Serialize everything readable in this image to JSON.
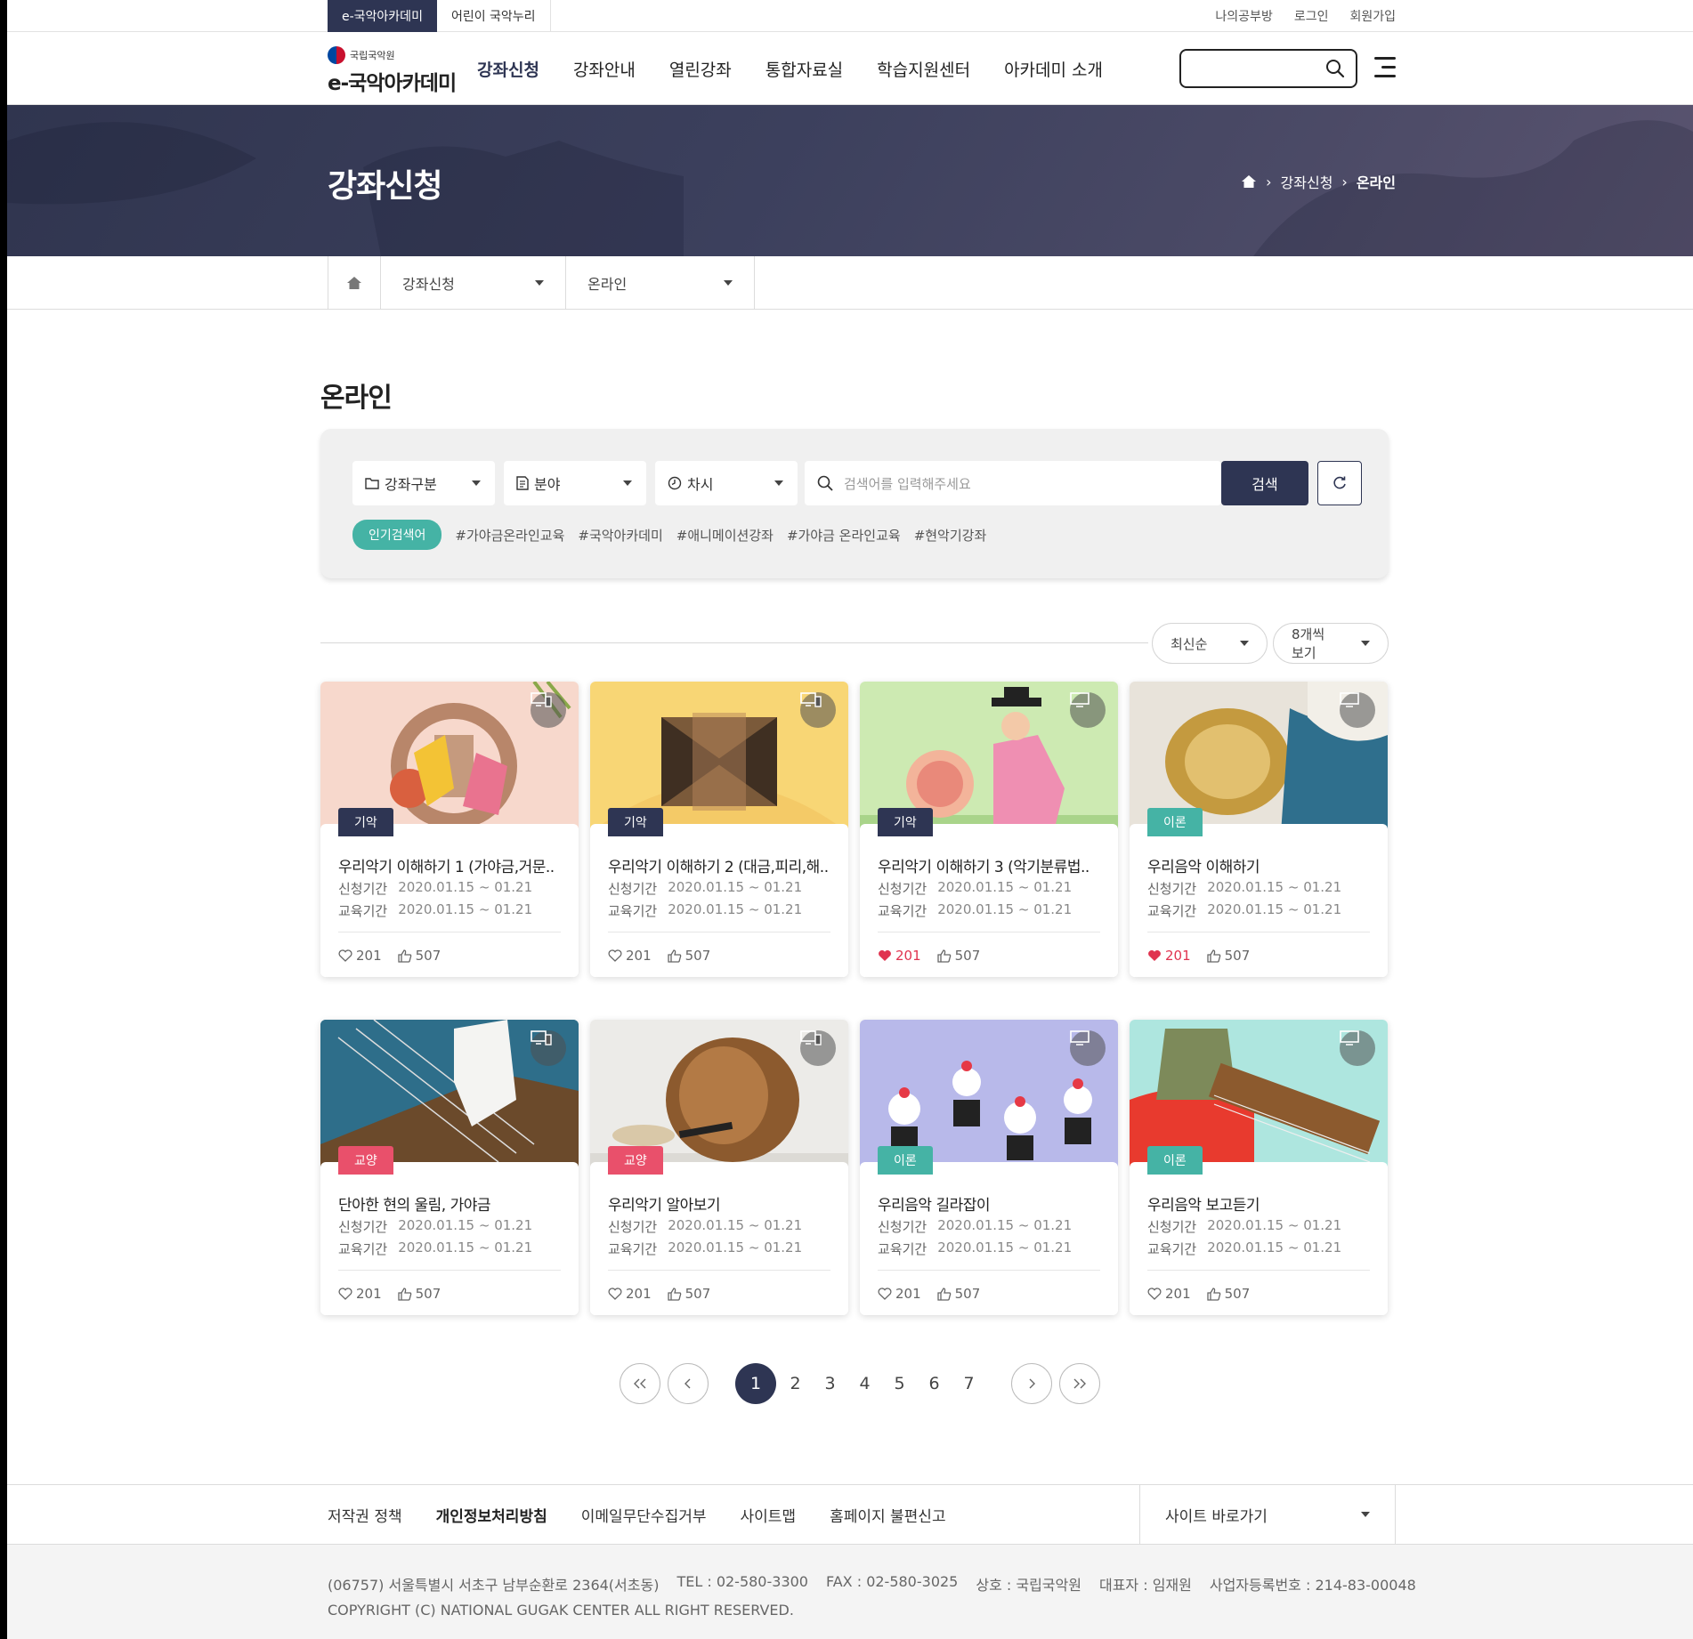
{
  "top": {
    "site_tabs": [
      "e-국악아카데미",
      "어린이 국악누리"
    ],
    "util_links": [
      "나의공부방",
      "로그인",
      "회원가입"
    ]
  },
  "header": {
    "logo_sub": "국립국악원",
    "logo_main": "e-국악아카데미",
    "nav": [
      "강좌신청",
      "강좌안내",
      "열린강좌",
      "통합자료실",
      "학습지원센터",
      "아카데미 소개"
    ],
    "active_nav_index": 0
  },
  "hero": {
    "title": "강좌신청",
    "breadcrumb": [
      "강좌신청",
      "온라인"
    ]
  },
  "subnav": {
    "select1": "강좌신청",
    "select2": "온라인"
  },
  "section": {
    "title": "온라인"
  },
  "filter": {
    "selects": [
      {
        "label": "강좌구분",
        "icon": "folder-icon"
      },
      {
        "label": "분야",
        "icon": "document-icon"
      },
      {
        "label": "차시",
        "icon": "clock-icon"
      }
    ],
    "search_placeholder": "검색어를 입력해주세요",
    "search_button": "검색",
    "popular_label": "인기검색어",
    "popular_tags": [
      "#가야금온라인교육",
      "#국악아카데미",
      "#애니메이션강좌",
      "#가야금 온라인교육",
      "#현악기강좌"
    ]
  },
  "sort": {
    "order": "최신순",
    "per_page": "8개씩 보기"
  },
  "card_labels": {
    "apply": "신청기간",
    "edu": "교육기간"
  },
  "cards": [
    {
      "category": "기악",
      "cat_color": "#2e3553",
      "device": "multi",
      "title": "우리악기 이해하기 1 (가야금,거문..",
      "apply": "2020.01.15 ~ 01.21",
      "edu": "2020.01.15 ~ 01.21",
      "likes": "201",
      "thumbs": "507",
      "liked": false,
      "bg": "#f7d8cc"
    },
    {
      "category": "기악",
      "cat_color": "#2e3553",
      "device": "multi",
      "title": "우리악기 이해하기 2 (대금,피리,해..",
      "apply": "2020.01.15 ~ 01.21",
      "edu": "2020.01.15 ~ 01.21",
      "likes": "201",
      "thumbs": "507",
      "liked": false,
      "bg": "#f8d675"
    },
    {
      "category": "기악",
      "cat_color": "#2e3553",
      "device": "pc",
      "title": "우리악기 이해하기 3 (악기분류법..",
      "apply": "2020.01.15 ~ 01.21",
      "edu": "2020.01.15 ~ 01.21",
      "likes": "201",
      "thumbs": "507",
      "liked": true,
      "bg": "#cdeab2"
    },
    {
      "category": "이론",
      "cat_color": "#45b3a5",
      "device": "pc",
      "title": "우리음악 이해하기",
      "apply": "2020.01.15 ~ 01.21",
      "edu": "2020.01.15 ~ 01.21",
      "likes": "201",
      "thumbs": "507",
      "liked": true,
      "bg": "#e8e3da"
    },
    {
      "category": "교양",
      "cat_color": "#e9506b",
      "device": "multi",
      "title": "단아한 현의 울림, 가야금",
      "apply": "2020.01.15 ~ 01.21",
      "edu": "2020.01.15 ~ 01.21",
      "likes": "201",
      "thumbs": "507",
      "liked": false,
      "bg": "#2e6e8a"
    },
    {
      "category": "교양",
      "cat_color": "#e9506b",
      "device": "multi",
      "title": "우리악기 알아보기",
      "apply": "2020.01.15 ~ 01.21",
      "edu": "2020.01.15 ~ 01.21",
      "likes": "201",
      "thumbs": "507",
      "liked": false,
      "bg": "#ecebe8"
    },
    {
      "category": "이론",
      "cat_color": "#45b3a5",
      "device": "pc",
      "title": "우리음악 길라잡이",
      "apply": "2020.01.15 ~ 01.21",
      "edu": "2020.01.15 ~ 01.21",
      "likes": "201",
      "thumbs": "507",
      "liked": false,
      "bg": "#b8b9ea"
    },
    {
      "category": "이론",
      "cat_color": "#45b3a5",
      "device": "pc",
      "title": "우리음악 보고듣기",
      "apply": "2020.01.15 ~ 01.21",
      "edu": "2020.01.15 ~ 01.21",
      "likes": "201",
      "thumbs": "507",
      "liked": false,
      "bg": "#aee6df"
    }
  ],
  "pager": {
    "pages": [
      "1",
      "2",
      "3",
      "4",
      "5",
      "6",
      "7"
    ],
    "current": "1"
  },
  "footer": {
    "links": [
      "저작권 정책",
      "개인정보처리방침",
      "이메일무단수집거부",
      "사이트맵",
      "홈페이지 불편신고"
    ],
    "strong_index": 1,
    "site_go": "사이트 바로가기",
    "address": [
      "(06757) 서울특별시 서초구 남부순환로 2364(서초동)",
      "TEL : 02-580-3300",
      "FAX : 02-580-3025",
      "상호 : 국립국악원",
      "대표자 : 임재원",
      "사업자등록번호 : 214-83-00048"
    ],
    "copyright": "COPYRIGHT (C) NATIONAL GUGAK CENTER ALL RIGHT RESERVED."
  }
}
